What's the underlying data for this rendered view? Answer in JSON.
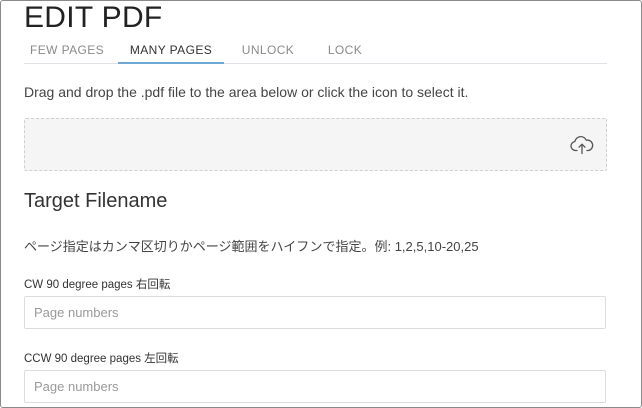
{
  "header": {
    "title": "EDIT PDF"
  },
  "tabs": [
    {
      "label": "FEW PAGES",
      "active": false
    },
    {
      "label": "MANY PAGES",
      "active": true
    },
    {
      "label": "UNLOCK",
      "active": false
    },
    {
      "label": "LOCK",
      "active": false
    }
  ],
  "upload": {
    "instruction": "Drag and drop the .pdf file to the area below or click the icon to select it.",
    "icon": "cloud-upload-icon"
  },
  "target": {
    "title": "Target Filename",
    "hint": "ページ指定はカンマ区切りかページ範囲をハイフンで指定。例: 1,2,5,10-20,25"
  },
  "fields": {
    "cw": {
      "label": "CW 90 degree pages 右回転",
      "value": "",
      "placeholder": "Page numbers"
    },
    "ccw": {
      "label": "CCW 90 degree pages 左回転",
      "value": "",
      "placeholder": "Page numbers"
    }
  },
  "colors": {
    "active_tab_underline": "#6ea6d6",
    "dropzone_background": "#f5f5f5",
    "muted_text": "#8a8a8a"
  }
}
